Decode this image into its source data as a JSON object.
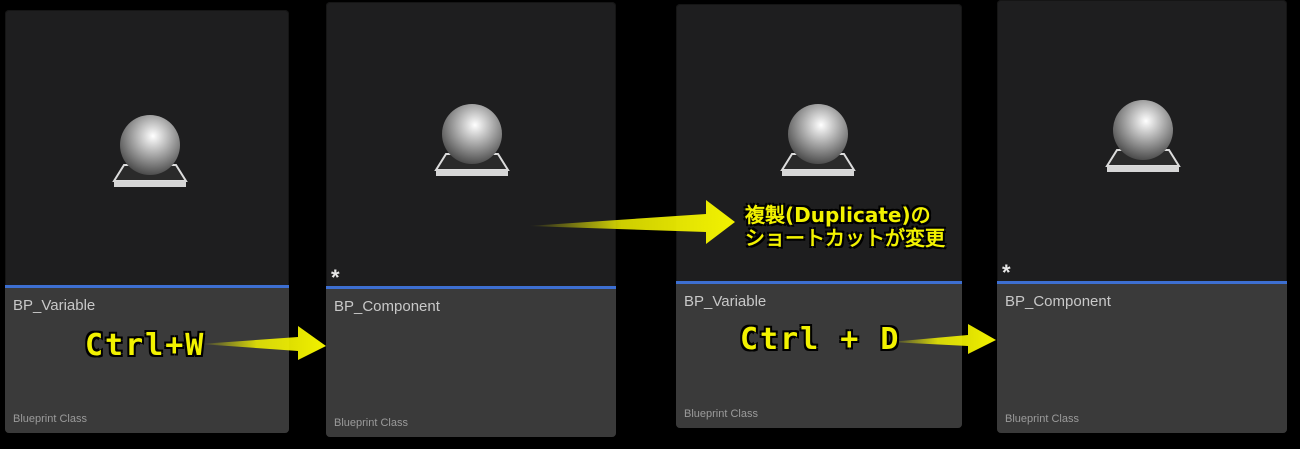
{
  "tiles": [
    {
      "name": "BP_Variable",
      "type": "Blueprint Class",
      "modified": false
    },
    {
      "name": "BP_Component",
      "type": "Blueprint Class",
      "modified": true,
      "modified_marker": "*"
    },
    {
      "name": "BP_Variable",
      "type": "Blueprint Class",
      "modified": false
    },
    {
      "name": "BP_Component",
      "type": "Blueprint Class",
      "modified": true,
      "modified_marker": "*"
    }
  ],
  "annotations": {
    "shortcut_old": "Ctrl+W",
    "shortcut_new": "Ctrl + D",
    "note_line1": "複製(Duplicate)の",
    "note_line2": "ショートカットが変更"
  },
  "colors": {
    "background": "#000000",
    "tile_thumb": "#1e1e1f",
    "tile_info": "#3a3a3a",
    "accent_bar": "#3d6fd1",
    "annotation": "#f2f200"
  },
  "icons": {
    "asset_thumbnail": "sphere-on-pedestal-icon"
  }
}
